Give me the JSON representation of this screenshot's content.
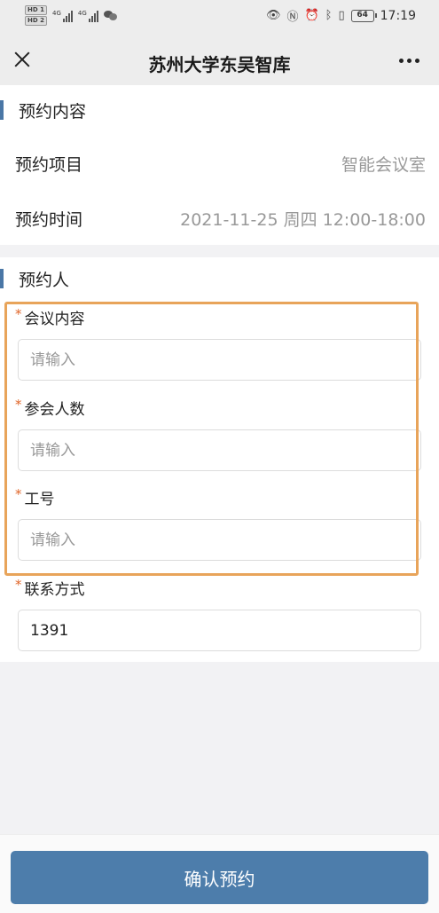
{
  "status_bar": {
    "sim1": "HD 1",
    "sim2": "HD 2",
    "net1": "4G",
    "net2": "4G",
    "battery": "64",
    "time": "17:19"
  },
  "header": {
    "title": "苏州大学东吴智库"
  },
  "reservation_content": {
    "section_title": "预约内容",
    "item_label": "预约项目",
    "item_value": "智能会议室",
    "time_label": "预约时间",
    "time_value": "2021-11-25 周四 12:00-18:00"
  },
  "reserver": {
    "section_title": "预约人",
    "required_mark": "*",
    "fields": [
      {
        "label": "会议内容",
        "placeholder": "请输入",
        "value": ""
      },
      {
        "label": "参会人数",
        "placeholder": "请输入",
        "value": ""
      },
      {
        "label": "工号",
        "placeholder": "请输入",
        "value": ""
      },
      {
        "label": "联系方式",
        "placeholder": "",
        "value": "1391"
      }
    ]
  },
  "footer": {
    "confirm_label": "确认预约"
  },
  "colors": {
    "accent": "#4d7dab",
    "required": "#e0662a",
    "highlight": "#e8a45a"
  }
}
